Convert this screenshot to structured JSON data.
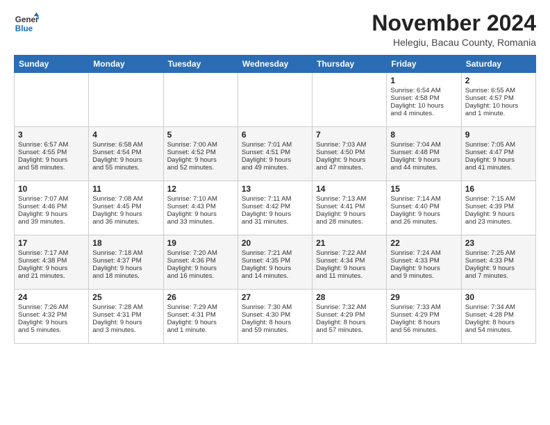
{
  "logo": {
    "line1": "General",
    "line2": "Blue"
  },
  "title": "November 2024",
  "location": "Helegiu, Bacau County, Romania",
  "headers": [
    "Sunday",
    "Monday",
    "Tuesday",
    "Wednesday",
    "Thursday",
    "Friday",
    "Saturday"
  ],
  "weeks": [
    [
      {
        "day": "",
        "info": ""
      },
      {
        "day": "",
        "info": ""
      },
      {
        "day": "",
        "info": ""
      },
      {
        "day": "",
        "info": ""
      },
      {
        "day": "",
        "info": ""
      },
      {
        "day": "1",
        "info": "Sunrise: 6:54 AM\nSunset: 4:58 PM\nDaylight: 10 hours\nand 4 minutes."
      },
      {
        "day": "2",
        "info": "Sunrise: 6:55 AM\nSunset: 4:57 PM\nDaylight: 10 hours\nand 1 minute."
      }
    ],
    [
      {
        "day": "3",
        "info": "Sunrise: 6:57 AM\nSunset: 4:55 PM\nDaylight: 9 hours\nand 58 minutes."
      },
      {
        "day": "4",
        "info": "Sunrise: 6:58 AM\nSunset: 4:54 PM\nDaylight: 9 hours\nand 55 minutes."
      },
      {
        "day": "5",
        "info": "Sunrise: 7:00 AM\nSunset: 4:52 PM\nDaylight: 9 hours\nand 52 minutes."
      },
      {
        "day": "6",
        "info": "Sunrise: 7:01 AM\nSunset: 4:51 PM\nDaylight: 9 hours\nand 49 minutes."
      },
      {
        "day": "7",
        "info": "Sunrise: 7:03 AM\nSunset: 4:50 PM\nDaylight: 9 hours\nand 47 minutes."
      },
      {
        "day": "8",
        "info": "Sunrise: 7:04 AM\nSunset: 4:48 PM\nDaylight: 9 hours\nand 44 minutes."
      },
      {
        "day": "9",
        "info": "Sunrise: 7:05 AM\nSunset: 4:47 PM\nDaylight: 9 hours\nand 41 minutes."
      }
    ],
    [
      {
        "day": "10",
        "info": "Sunrise: 7:07 AM\nSunset: 4:46 PM\nDaylight: 9 hours\nand 39 minutes."
      },
      {
        "day": "11",
        "info": "Sunrise: 7:08 AM\nSunset: 4:45 PM\nDaylight: 9 hours\nand 36 minutes."
      },
      {
        "day": "12",
        "info": "Sunrise: 7:10 AM\nSunset: 4:43 PM\nDaylight: 9 hours\nand 33 minutes."
      },
      {
        "day": "13",
        "info": "Sunrise: 7:11 AM\nSunset: 4:42 PM\nDaylight: 9 hours\nand 31 minutes."
      },
      {
        "day": "14",
        "info": "Sunrise: 7:13 AM\nSunset: 4:41 PM\nDaylight: 9 hours\nand 28 minutes."
      },
      {
        "day": "15",
        "info": "Sunrise: 7:14 AM\nSunset: 4:40 PM\nDaylight: 9 hours\nand 26 minutes."
      },
      {
        "day": "16",
        "info": "Sunrise: 7:15 AM\nSunset: 4:39 PM\nDaylight: 9 hours\nand 23 minutes."
      }
    ],
    [
      {
        "day": "17",
        "info": "Sunrise: 7:17 AM\nSunset: 4:38 PM\nDaylight: 9 hours\nand 21 minutes."
      },
      {
        "day": "18",
        "info": "Sunrise: 7:18 AM\nSunset: 4:37 PM\nDaylight: 9 hours\nand 18 minutes."
      },
      {
        "day": "19",
        "info": "Sunrise: 7:20 AM\nSunset: 4:36 PM\nDaylight: 9 hours\nand 16 minutes."
      },
      {
        "day": "20",
        "info": "Sunrise: 7:21 AM\nSunset: 4:35 PM\nDaylight: 9 hours\nand 14 minutes."
      },
      {
        "day": "21",
        "info": "Sunrise: 7:22 AM\nSunset: 4:34 PM\nDaylight: 9 hours\nand 11 minutes."
      },
      {
        "day": "22",
        "info": "Sunrise: 7:24 AM\nSunset: 4:33 PM\nDaylight: 9 hours\nand 9 minutes."
      },
      {
        "day": "23",
        "info": "Sunrise: 7:25 AM\nSunset: 4:33 PM\nDaylight: 9 hours\nand 7 minutes."
      }
    ],
    [
      {
        "day": "24",
        "info": "Sunrise: 7:26 AM\nSunset: 4:32 PM\nDaylight: 9 hours\nand 5 minutes."
      },
      {
        "day": "25",
        "info": "Sunrise: 7:28 AM\nSunset: 4:31 PM\nDaylight: 9 hours\nand 3 minutes."
      },
      {
        "day": "26",
        "info": "Sunrise: 7:29 AM\nSunset: 4:31 PM\nDaylight: 9 hours\nand 1 minute."
      },
      {
        "day": "27",
        "info": "Sunrise: 7:30 AM\nSunset: 4:30 PM\nDaylight: 8 hours\nand 59 minutes."
      },
      {
        "day": "28",
        "info": "Sunrise: 7:32 AM\nSunset: 4:29 PM\nDaylight: 8 hours\nand 57 minutes."
      },
      {
        "day": "29",
        "info": "Sunrise: 7:33 AM\nSunset: 4:29 PM\nDaylight: 8 hours\nand 56 minutes."
      },
      {
        "day": "30",
        "info": "Sunrise: 7:34 AM\nSunset: 4:28 PM\nDaylight: 8 hours\nand 54 minutes."
      }
    ]
  ]
}
